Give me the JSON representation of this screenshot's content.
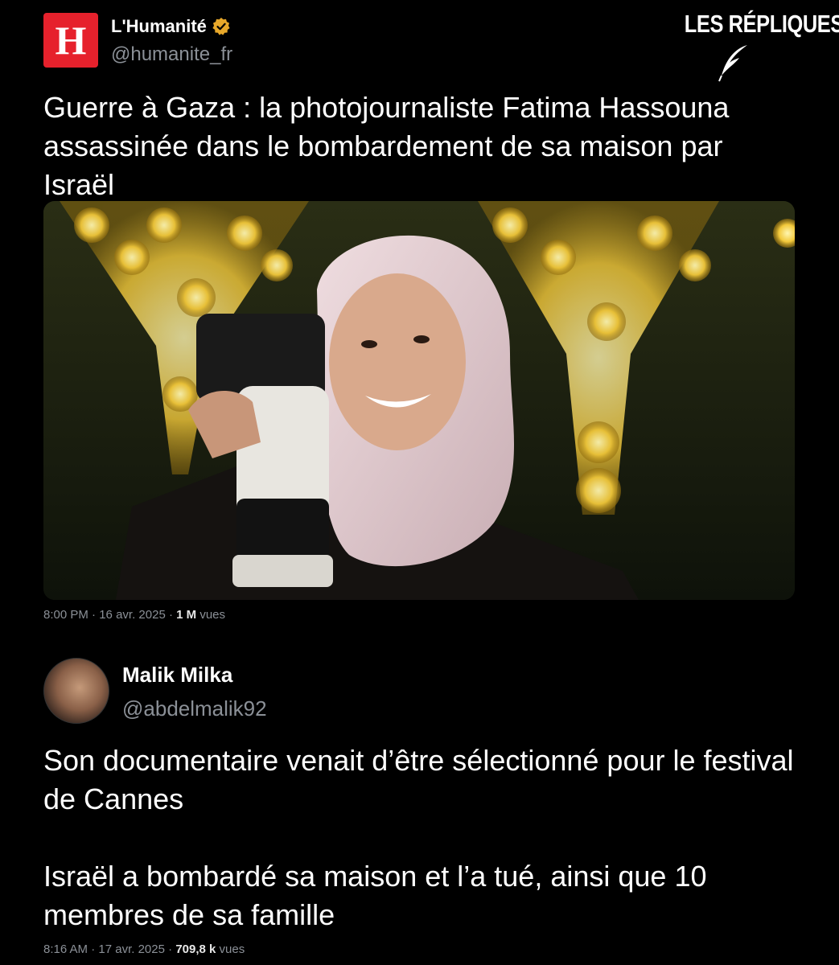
{
  "brand": {
    "text": "LES RÉPLIQUES",
    "icon": "quill-icon"
  },
  "tweet1": {
    "logo_letter": "H",
    "logo_color": "#e6212c",
    "name": "L'Humanité",
    "verified_icon": "verified-badge-icon",
    "verified_color": "#e8a82a",
    "handle": "@humanite_fr",
    "text": "Guerre à Gaza : la photojournaliste Fatima Hassouna assassinée dans le bombardement de sa maison par Israël",
    "time": "8:00 PM",
    "date": "16 avr. 2025",
    "views_count": "1 M",
    "views_label": "vues"
  },
  "tweet2": {
    "name": "Malik Milka",
    "handle": "@abdelmalik92",
    "paragraph1": "Son documentaire venait d’être sélectionné pour le festival de Cannes",
    "paragraph2": "Israël a bombardé sa maison et l’a tué, ainsi que 10 membres de sa famille",
    "time": "8:16 AM",
    "date": "17 avr. 2025",
    "views_count": "709,8 k",
    "views_label": "vues"
  },
  "separator": "·"
}
